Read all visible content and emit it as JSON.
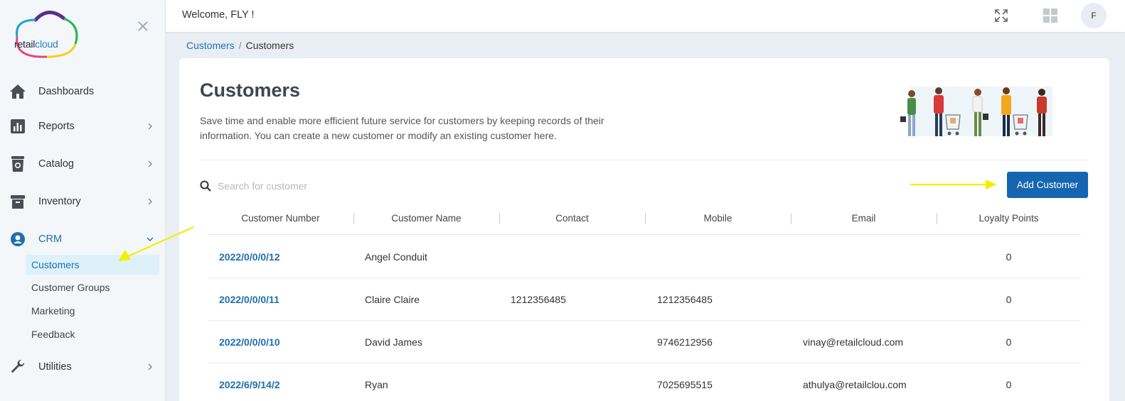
{
  "brand": {
    "logo_text_a": "retail",
    "logo_text_b": "cloud"
  },
  "topbar": {
    "welcome": "Welcome, FLY !",
    "avatar_initial": "F"
  },
  "sidebar": {
    "items": [
      {
        "label": "Dashboards",
        "icon": "home-icon"
      },
      {
        "label": "Reports",
        "icon": "bar-chart-icon"
      },
      {
        "label": "Catalog",
        "icon": "catalog-icon"
      },
      {
        "label": "Inventory",
        "icon": "archive-icon"
      },
      {
        "label": "CRM",
        "icon": "user-circle-icon"
      },
      {
        "label": "Utilities",
        "icon": "wrench-icon"
      }
    ],
    "crm_sub": [
      "Customers",
      "Customer Groups",
      "Marketing",
      "Feedback"
    ]
  },
  "breadcrumb": {
    "parent": "Customers",
    "separator": "/",
    "current": "Customers"
  },
  "page": {
    "title": "Customers",
    "description": "Save time and enable more efficient future service for customers by keeping records of their information. You can create a new customer or modify an existing customer here."
  },
  "search": {
    "placeholder": "Search for customer"
  },
  "actions": {
    "add_customer": "Add Customer"
  },
  "table": {
    "columns": [
      "Customer Number",
      "Customer Name",
      "Contact",
      "Mobile",
      "Email",
      "Loyalty Points"
    ],
    "rows": [
      {
        "number": "2022/0/0/0/12",
        "name": "Angel Conduit",
        "contact": "",
        "mobile": "",
        "email": "",
        "points": "0"
      },
      {
        "number": "2022/0/0/0/11",
        "name": "Claire Claire",
        "contact": "1212356485",
        "mobile": "1212356485",
        "email": "",
        "points": "0"
      },
      {
        "number": "2022/0/0/0/10",
        "name": "David James",
        "contact": "",
        "mobile": "9746212956",
        "email": "vinay@retailcloud.com",
        "points": "0"
      },
      {
        "number": "2022/6/9/14/2",
        "name": "Ryan",
        "contact": "",
        "mobile": "7025695515",
        "email": "athulya@retailclou.com",
        "points": "0"
      }
    ]
  },
  "colors": {
    "accent": "#1565b0",
    "link": "#1f6fb0",
    "arrow": "#f0f000"
  }
}
